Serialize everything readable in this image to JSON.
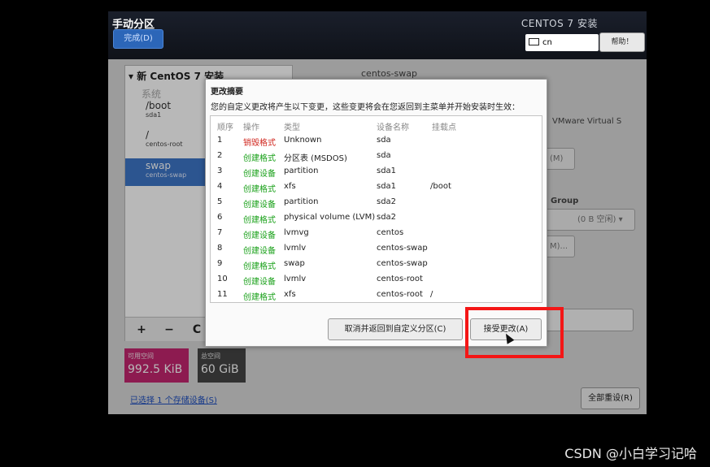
{
  "header": {
    "title": "手动分区",
    "done_label": "完成(D)",
    "os_title": "CENTOS 7 安装",
    "keyboard_layout": "cn",
    "help_label": "帮助！"
  },
  "left_panel": {
    "tree_title": "新 CentOS 7 安装",
    "system_label": "系统",
    "partitions": [
      {
        "name": "/boot",
        "device": "sda1"
      },
      {
        "name": "/",
        "device": "centos-root"
      },
      {
        "name": "swap",
        "device": "centos-swap"
      }
    ],
    "controls": {
      "add": "+",
      "remove": "−",
      "refresh": "C"
    }
  },
  "space": {
    "available_label": "可用空间",
    "available_value": "992.5 KiB",
    "total_label": "总空间",
    "total_value": "60 GiB"
  },
  "storage_link": "已选择 1 个存储设备(S)",
  "reset_label": "全部重设(R)",
  "background": {
    "right_title": "centos-swap",
    "device_text": "VMware Virtual S",
    "modify_btn": "(M)",
    "group_label": "Group",
    "group_select": "(0 B 空闲)",
    "modify_btn2": "M)..."
  },
  "dialog": {
    "title": "更改摘要",
    "subtitle": "您的自定义更改将产生以下变更，这些变更将会在您返回到主菜单并开始安装时生效：",
    "headers": {
      "order": "顺序",
      "action": "操作",
      "type": "类型",
      "device": "设备名称",
      "mount": "挂载点"
    },
    "rows": [
      {
        "order": "1",
        "action": "销毁格式",
        "action_color": "red",
        "type": "Unknown",
        "device": "sda",
        "mount": ""
      },
      {
        "order": "2",
        "action": "创建格式",
        "action_color": "green",
        "type": "分区表 (MSDOS)",
        "device": "sda",
        "mount": ""
      },
      {
        "order": "3",
        "action": "创建设备",
        "action_color": "green",
        "type": "partition",
        "device": "sda1",
        "mount": ""
      },
      {
        "order": "4",
        "action": "创建格式",
        "action_color": "green",
        "type": "xfs",
        "device": "sda1",
        "mount": "/boot"
      },
      {
        "order": "5",
        "action": "创建设备",
        "action_color": "green",
        "type": "partition",
        "device": "sda2",
        "mount": ""
      },
      {
        "order": "6",
        "action": "创建格式",
        "action_color": "green",
        "type": "physical volume (LVM)",
        "device": "sda2",
        "mount": ""
      },
      {
        "order": "7",
        "action": "创建设备",
        "action_color": "green",
        "type": "lvmvg",
        "device": "centos",
        "mount": ""
      },
      {
        "order": "8",
        "action": "创建设备",
        "action_color": "green",
        "type": "lvmlv",
        "device": "centos-swap",
        "mount": ""
      },
      {
        "order": "9",
        "action": "创建格式",
        "action_color": "green",
        "type": "swap",
        "device": "centos-swap",
        "mount": ""
      },
      {
        "order": "10",
        "action": "创建设备",
        "action_color": "green",
        "type": "lvmlv",
        "device": "centos-root",
        "mount": ""
      },
      {
        "order": "11",
        "action": "创建格式",
        "action_color": "green",
        "type": "xfs",
        "device": "centos-root",
        "mount": "/"
      }
    ],
    "cancel_label": "取消并返回到自定义分区(C)",
    "accept_label": "接受更改(A)"
  },
  "colors": {
    "destroy": "#d0261e",
    "create": "#18a018",
    "selection": "#3d76c8",
    "highlight": "#f41616"
  },
  "watermark": "CSDN @小白学习记哈"
}
